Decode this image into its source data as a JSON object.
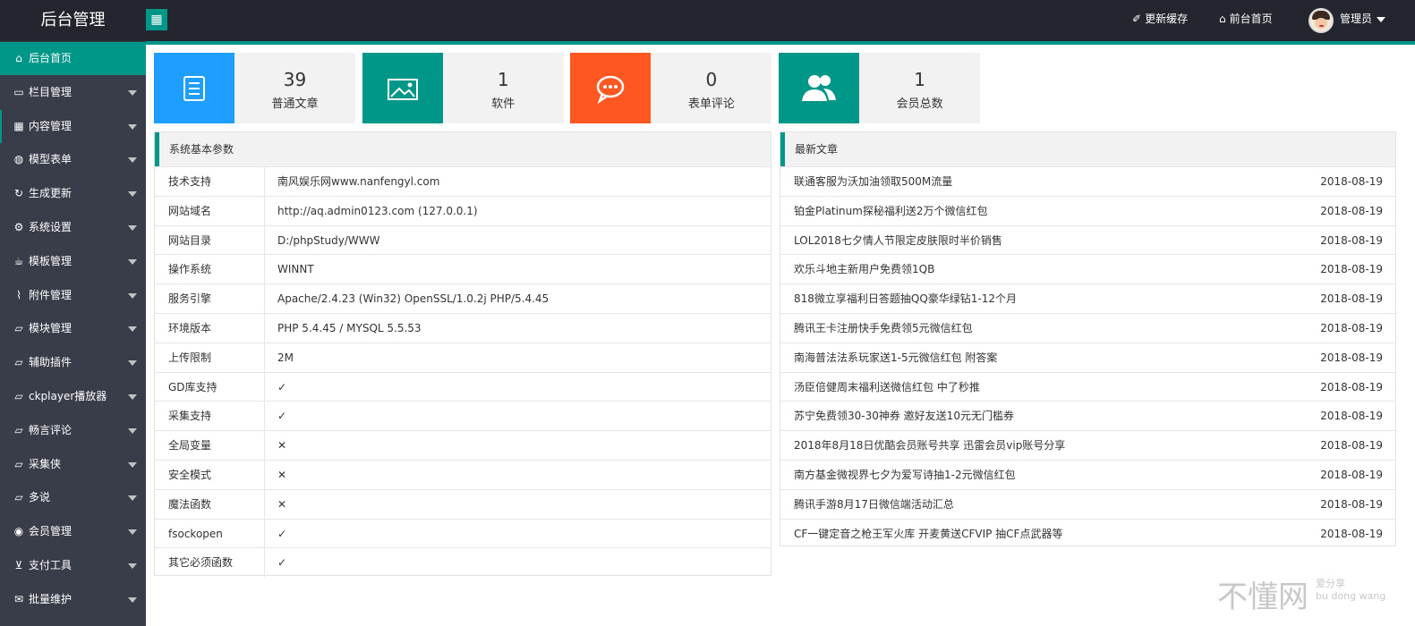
{
  "header": {
    "title": "后台管理",
    "refresh_cache": "更新缓存",
    "front_home": "前台首页",
    "user": "管理员"
  },
  "sidebar": {
    "items": [
      {
        "label": "后台首页",
        "icon": "home-icon",
        "active": true
      },
      {
        "label": "栏目管理",
        "icon": "monitor-icon"
      },
      {
        "label": "内容管理",
        "icon": "grid-icon"
      },
      {
        "label": "模型表单",
        "icon": "globe-icon"
      },
      {
        "label": "生成更新",
        "icon": "refresh-icon"
      },
      {
        "label": "系统设置",
        "icon": "gear-icon"
      },
      {
        "label": "模板管理",
        "icon": "cup-icon"
      },
      {
        "label": "附件管理",
        "icon": "paperclip-icon"
      },
      {
        "label": "模块管理",
        "icon": "folder-icon"
      },
      {
        "label": "辅助插件",
        "icon": "folder-icon"
      },
      {
        "label": "ckplayer播放器",
        "icon": "folder-icon"
      },
      {
        "label": "畅言评论",
        "icon": "folder-icon"
      },
      {
        "label": "采集侠",
        "icon": "folder-icon"
      },
      {
        "label": "多说",
        "icon": "folder-icon"
      },
      {
        "label": "会员管理",
        "icon": "user-icon"
      },
      {
        "label": "支付工具",
        "icon": "cart-icon"
      },
      {
        "label": "批量维护",
        "icon": "mail-icon"
      }
    ]
  },
  "stats": [
    {
      "number": "39",
      "label": "普通文章",
      "color": "#1e9fff",
      "icon": "article-icon"
    },
    {
      "number": "1",
      "label": "软件",
      "color": "#009688",
      "icon": "image-icon"
    },
    {
      "number": "0",
      "label": "表单评论",
      "color": "#ff5722",
      "icon": "comment-icon"
    },
    {
      "number": "1",
      "label": "会员总数",
      "color": "#009688",
      "icon": "users-icon"
    }
  ],
  "system": {
    "title": "系统基本参数",
    "rows": [
      {
        "key": "技术支持",
        "value": "南风娱乐网www.nanfengyl.com"
      },
      {
        "key": "网站域名",
        "value": "http://aq.admin0123.com (127.0.0.1)"
      },
      {
        "key": "网站目录",
        "value": "D:/phpStudy/WWW"
      },
      {
        "key": "操作系统",
        "value": "WINNT"
      },
      {
        "key": "服务引擎",
        "value": "Apache/2.4.23 (Win32) OpenSSL/1.0.2j PHP/5.4.45"
      },
      {
        "key": "环境版本",
        "value": "PHP 5.4.45 / MYSQL 5.5.53"
      },
      {
        "key": "上传限制",
        "value": "2M"
      },
      {
        "key": "GD库支持",
        "value": "✓"
      },
      {
        "key": "采集支持",
        "value": "✓"
      },
      {
        "key": "全局变量",
        "value": "✕"
      },
      {
        "key": "安全模式",
        "value": "✕"
      },
      {
        "key": "魔法函数",
        "value": "✕"
      },
      {
        "key": "fsockopen",
        "value": "✓"
      },
      {
        "key": "其它必须函数",
        "value": "✓"
      }
    ]
  },
  "articles": {
    "title": "最新文章",
    "rows": [
      {
        "title": "联通客服为沃加油领取500M流量",
        "date": "2018-08-19"
      },
      {
        "title": "铂金Platinum探秘福利送2万个微信红包",
        "date": "2018-08-19"
      },
      {
        "title": "LOL2018七夕情人节限定皮肤限时半价销售",
        "date": "2018-08-19"
      },
      {
        "title": "欢乐斗地主新用户免费领1QB",
        "date": "2018-08-19"
      },
      {
        "title": "818微立享福利日答题抽QQ豪华绿钻1-12个月",
        "date": "2018-08-19"
      },
      {
        "title": "腾讯王卡注册快手免费领5元微信红包",
        "date": "2018-08-19"
      },
      {
        "title": "南海普法法系玩家送1-5元微信红包 附答案",
        "date": "2018-08-19"
      },
      {
        "title": "汤臣倍健周末福利送微信红包 中了秒推",
        "date": "2018-08-19"
      },
      {
        "title": "苏宁免费领30-30神券 邀好友送10元无门槛券",
        "date": "2018-08-19"
      },
      {
        "title": "2018年8月18日优酷会员账号共享 迅雷会员vip账号分享",
        "date": "2018-08-19"
      },
      {
        "title": "南方基金微视界七夕为爱写诗抽1-2元微信红包",
        "date": "2018-08-19"
      },
      {
        "title": "腾讯手游8月17日微信端活动汇总",
        "date": "2018-08-19"
      },
      {
        "title": "CF一键定音之枪王军火库 开麦黄送CFVIP 抽CF点武器等",
        "date": "2018-08-19"
      }
    ]
  },
  "watermark": {
    "main": "不懂网",
    "sub1": "爱分享",
    "sub2": "bu dong wang"
  }
}
